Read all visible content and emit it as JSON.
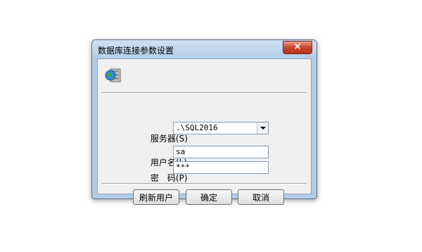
{
  "window": {
    "title": "数据库连接参数设置",
    "close_glyph": "×"
  },
  "icons": {
    "app": "database-globe-icon",
    "close": "close-icon",
    "dropdown": "chevron-down-icon"
  },
  "form": {
    "server": {
      "label": "服务器",
      "hotkey": "(S)",
      "value": ".\\SQL2016"
    },
    "username": {
      "label": "用户名",
      "hotkey": "(L)",
      "value": "sa"
    },
    "password": {
      "label": "密　码",
      "hotkey": "(P)",
      "value": "***"
    }
  },
  "buttons": {
    "refresh": "刷新用户",
    "ok": "确定",
    "cancel": "取消"
  },
  "colors": {
    "close_button": "#c8452e",
    "titlebar": "#b6cde8",
    "client": "#f0f0f0"
  }
}
